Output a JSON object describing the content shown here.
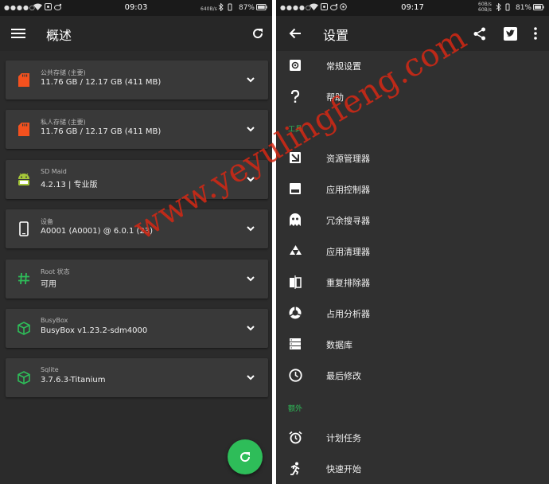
{
  "left": {
    "status": {
      "dots": "●●●●○",
      "time": "09:03",
      "speed": "640B/s",
      "battery": "87%"
    },
    "title": "概述",
    "cards": [
      {
        "label": "公共存储 (主要)",
        "value": "11.76 GB / 12.17 GB (411 MB)",
        "icon": "sd-card-icon"
      },
      {
        "label": "私人存储 (主要)",
        "value": "11.76 GB / 12.17 GB (411 MB)",
        "icon": "sd-card-icon"
      },
      {
        "label": "SD Maid",
        "value": "4.2.13 | 专业版",
        "icon": "android-icon"
      },
      {
        "label": "设备",
        "value": "A0001 (A0001) @ 6.0.1 (23)",
        "icon": "phone-icon"
      },
      {
        "label": "Root 状态",
        "value": "可用",
        "icon": "hash-icon"
      },
      {
        "label": "BusyBox",
        "value": "BusyBox v1.23.2-sdm4000",
        "icon": "cube-icon"
      },
      {
        "label": "Sqlite",
        "value": "3.7.6.3-Titanium",
        "icon": "cube-icon"
      }
    ]
  },
  "right": {
    "status": {
      "dots": "●●●●○",
      "time": "09:17",
      "speed_top": "60B/s",
      "speed_bottom": "60B/s",
      "battery": "81%"
    },
    "title": "设置",
    "items_top": [
      {
        "label": "常规设置",
        "icon": "gear-icon"
      },
      {
        "label": "帮助",
        "icon": "question-icon"
      }
    ],
    "section_tools": "工具",
    "tools": [
      {
        "label": "资源管理器",
        "icon": "explorer-icon"
      },
      {
        "label": "应用控制器",
        "icon": "app-control-icon"
      },
      {
        "label": "冗余搜寻器",
        "icon": "ghost-icon"
      },
      {
        "label": "应用清理器",
        "icon": "recycle-icon"
      },
      {
        "label": "重复排除器",
        "icon": "duplicate-icon"
      },
      {
        "label": "占用分析器",
        "icon": "donut-icon"
      },
      {
        "label": "数据库",
        "icon": "database-icon"
      },
      {
        "label": "最后修改",
        "icon": "clock-icon"
      }
    ],
    "section_extra": "额外",
    "extras": [
      {
        "label": "计划任务",
        "icon": "alarm-icon"
      },
      {
        "label": "快速开始",
        "icon": "run-icon"
      }
    ]
  },
  "watermark": "www.yeyulingfeng.com",
  "colors": {
    "accent": "#2ebd59",
    "sd_card": "#f4511e",
    "background": "#2b2b2b",
    "card": "#393939"
  }
}
